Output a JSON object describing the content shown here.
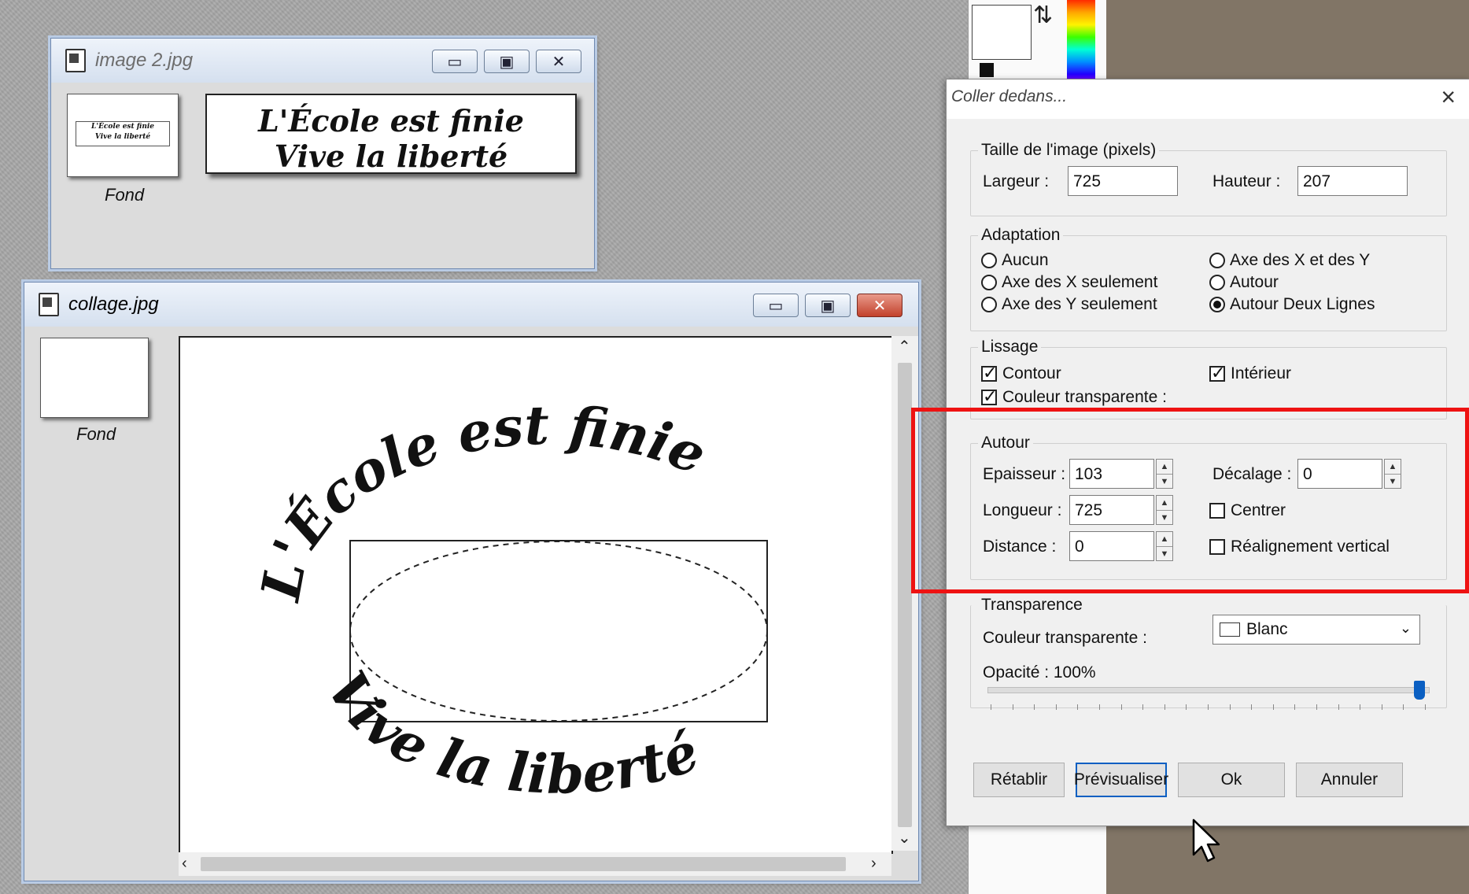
{
  "image2_window": {
    "title": "image 2.jpg",
    "thumb_label": "Fond",
    "text_line1": "L'École est finie",
    "text_line2": "Vive la liberté"
  },
  "collage_window": {
    "title": "collage.jpg",
    "thumb_label": "Fond",
    "arc_top": "L'École est finie",
    "arc_bottom": "Vive la liberté"
  },
  "dialog": {
    "title": "Coller dedans...",
    "taille": {
      "label": "Taille de l'image (pixels)",
      "largeur_label": "Largeur :",
      "largeur_value": "725",
      "hauteur_label": "Hauteur :",
      "hauteur_value": "207"
    },
    "adaptation": {
      "label": "Adaptation",
      "options": [
        "Aucun",
        "Axe des X seulement",
        "Axe des Y seulement",
        "Axe des X et des Y",
        "Autour",
        "Autour Deux Lignes"
      ],
      "selected": "Autour Deux Lignes"
    },
    "lissage": {
      "label": "Lissage",
      "contour": "Contour",
      "interieur": "Intérieur",
      "couleur_transparente": "Couleur transparente :"
    },
    "autour": {
      "label": "Autour",
      "epaisseur_label": "Epaisseur :",
      "epaisseur_value": "103",
      "longueur_label": "Longueur :",
      "longueur_value": "725",
      "distance_label": "Distance :",
      "distance_value": "0",
      "decalage_label": "Décalage :",
      "decalage_value": "0",
      "centrer": "Centrer",
      "realignement": "Réalignement vertical"
    },
    "transparence": {
      "label": "Transparence",
      "couleur_label": "Couleur transparente :",
      "couleur_value": "Blanc",
      "opacite_label": "Opacité : 100%",
      "opacity_fraction": 1.0
    },
    "buttons": {
      "retablir": "Rétablir",
      "previsualiser": "Prévisualiser",
      "ok": "Ok",
      "annuler": "Annuler"
    }
  },
  "colors": {
    "highlight": "#ee1212",
    "accent": "#0a5fc2"
  }
}
